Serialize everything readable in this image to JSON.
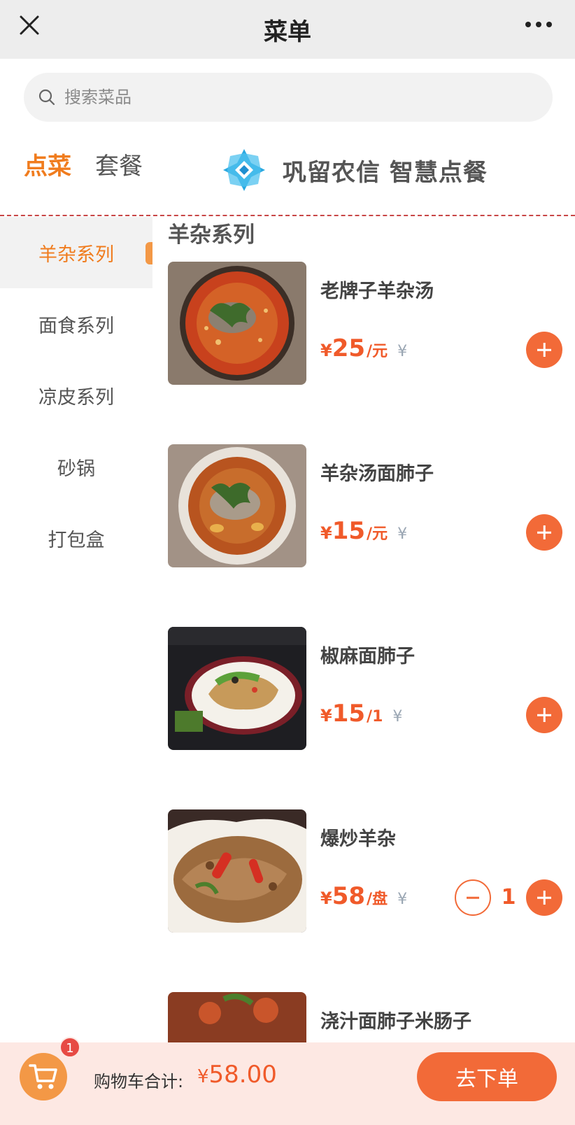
{
  "header": {
    "title": "菜单"
  },
  "search": {
    "placeholder": "搜索菜品"
  },
  "tabs": [
    {
      "label": "点菜",
      "active": true
    },
    {
      "label": "套餐",
      "active": false
    }
  ],
  "brand": {
    "text": "巩留农信 智慧点餐"
  },
  "sidebar": {
    "categories": [
      {
        "label": "羊杂系列",
        "active": true
      },
      {
        "label": "面食系列"
      },
      {
        "label": "凉皮系列"
      },
      {
        "label": "砂锅"
      },
      {
        "label": "打包盒"
      }
    ]
  },
  "section": {
    "title": "羊杂系列"
  },
  "items": [
    {
      "name": "老牌子羊杂汤",
      "currency": "¥",
      "price": "25",
      "unit": "/元",
      "yen": "¥",
      "qty": 0
    },
    {
      "name": "羊杂汤面肺子",
      "currency": "¥",
      "price": "15",
      "unit": "/元",
      "yen": "¥",
      "qty": 0
    },
    {
      "name": "椒麻面肺子",
      "currency": "¥",
      "price": "15",
      "unit": "/1",
      "yen": "¥",
      "qty": 0
    },
    {
      "name": "爆炒羊杂",
      "currency": "¥",
      "price": "58",
      "unit": "/盘",
      "yen": "¥",
      "qty": 1,
      "qty_text": "1"
    },
    {
      "name": "浇汁面肺子米肠子",
      "partial": true
    }
  ],
  "cart": {
    "badge": "1",
    "total_label": "购物车合计:",
    "currency": "¥",
    "total": "58.00",
    "order_label": "去下单"
  },
  "colors": {
    "accent": "#f07c1e",
    "price": "#f05a2a",
    "button": "#f26a38",
    "bottom_bg": "#fde8e3"
  },
  "icons": [
    "close-icon",
    "more-icon",
    "search-icon",
    "brand-logo-icon",
    "cart-icon"
  ]
}
